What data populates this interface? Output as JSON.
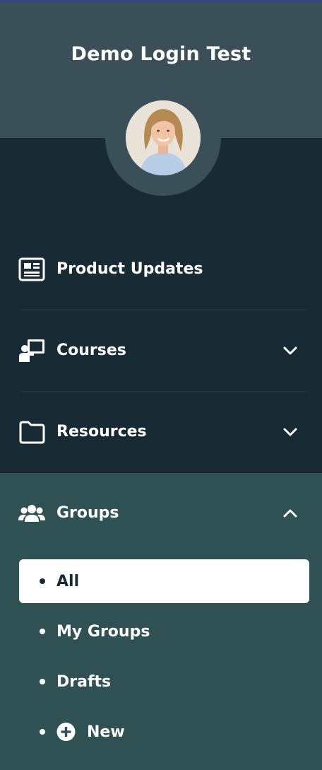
{
  "app": {
    "title": "Demo Login Test"
  },
  "colors": {
    "header": "#3a4f57",
    "nav_dark": "#182b34",
    "groups_panel": "#2f5153",
    "active_bg": "#ffffff"
  },
  "profile": {
    "avatar_icon": "user-avatar-photo"
  },
  "nav": {
    "items": [
      {
        "label": "Product Updates",
        "icon": "newspaper-icon"
      },
      {
        "label": "Courses",
        "icon": "presentation-board-icon",
        "expand_icon": "chevron-down-icon"
      },
      {
        "label": "Resources",
        "icon": "folder-icon",
        "expand_icon": "chevron-down-icon"
      }
    ],
    "groups": {
      "label": "Groups",
      "icon": "users-group-icon",
      "collapse_icon": "chevron-up-icon",
      "sub_items": [
        {
          "label": "All",
          "active": true
        },
        {
          "label": "My Groups"
        },
        {
          "label": "Drafts"
        },
        {
          "label": "New",
          "icon": "plus-circle-icon"
        }
      ]
    }
  }
}
